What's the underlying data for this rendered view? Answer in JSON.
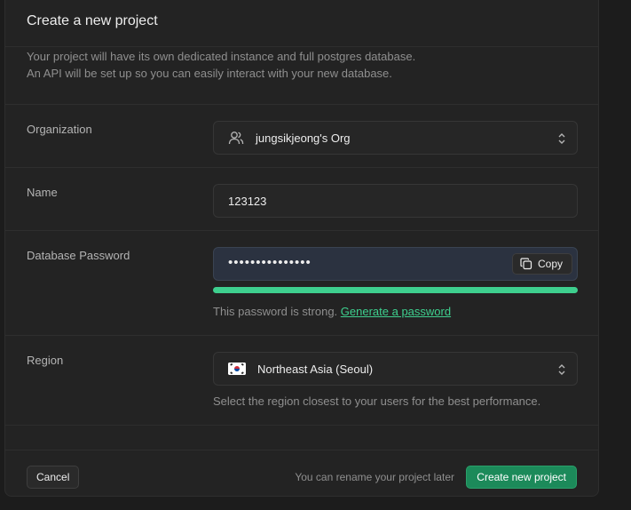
{
  "header": {
    "title": "Create a new project",
    "description_line1": "Your project will have its own dedicated instance and full postgres database.",
    "description_line2": "An API will be set up so you can easily interact with your new database."
  },
  "organization": {
    "label": "Organization",
    "value": "jungsikjeong's Org",
    "icon": "users-icon"
  },
  "name": {
    "label": "Name",
    "value": "123123"
  },
  "password": {
    "label": "Database Password",
    "masked_value": "•••••••••••••••",
    "copy_label": "Copy",
    "strength_text": "This password is strong.",
    "generate_link": "Generate a password",
    "strength_percent": 100,
    "strength_color": "#3ecf8e"
  },
  "region": {
    "label": "Region",
    "value": "Northeast Asia (Seoul)",
    "flag_icon": "south-korea-flag-icon",
    "help": "Select the region closest to your users for the best performance."
  },
  "footer": {
    "cancel_label": "Cancel",
    "hint": "You can rename your project later",
    "create_label": "Create new project"
  },
  "colors": {
    "accent": "#3ecf8e",
    "primary_button": "#1c8a5a",
    "background": "#232323"
  }
}
